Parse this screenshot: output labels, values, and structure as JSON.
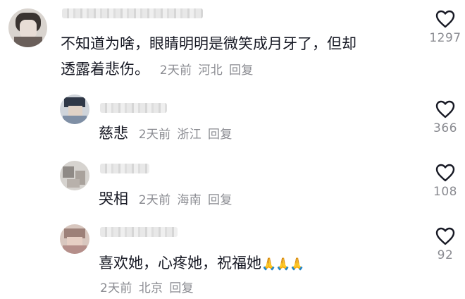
{
  "comments": [
    {
      "text_line1": "不知道为啥，眼睛明明是微笑成月牙了，但却",
      "text_line2": "透露着悲伤。",
      "time": "2天前",
      "location": "河北",
      "reply_label": "回复",
      "likes": "1297"
    },
    {
      "text": "慈悲",
      "time": "2天前",
      "location": "浙江",
      "reply_label": "回复",
      "likes": "366"
    },
    {
      "text": "哭相",
      "time": "2天前",
      "location": "海南",
      "reply_label": "回复",
      "likes": "108"
    },
    {
      "text": "喜欢她，心疼她，祝福她",
      "emoji": "🙏🙏🙏",
      "time": "2天前",
      "location": "北京",
      "reply_label": "回复",
      "likes": "92"
    }
  ],
  "icons": {
    "like": "heart-outline-icon"
  },
  "colors": {
    "text": "#161823",
    "meta": "#8a8b91"
  }
}
